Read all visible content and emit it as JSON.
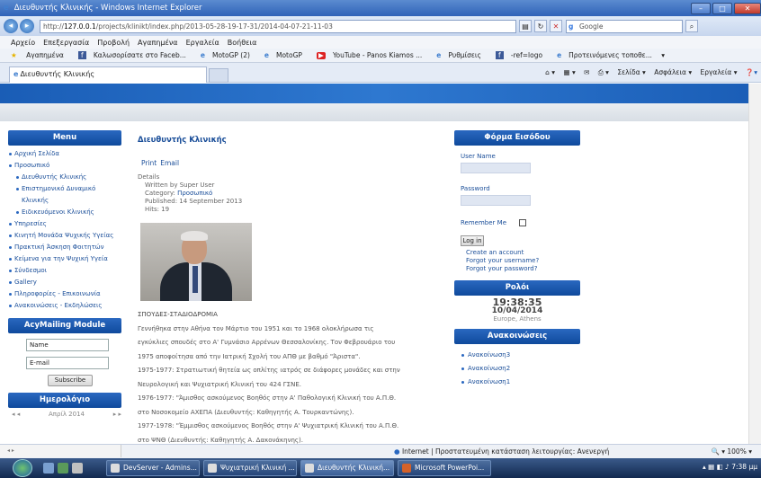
{
  "window": {
    "title": "Διευθυντής Κλινικής - Windows Internet Explorer"
  },
  "address": {
    "url_prefix": "http://",
    "url_host": "127.0.0.1",
    "url_path": "/projects/klinikt/index.php/2013-05-28-19-17-31/2014-04-07-21-11-03",
    "search_placeholder": "Google"
  },
  "menubar": [
    "Αρχείο",
    "Επεξεργασία",
    "Προβολή",
    "Αγαπημένα",
    "Εργαλεία",
    "Βοήθεια"
  ],
  "favorites": {
    "label": "Αγαπημένα",
    "items": [
      "Καλωσορίσατε στο Faceb...",
      "MotoGP (2)",
      "MotoGP",
      "YouTube - Panos Kiamos ...",
      "Ρυθμίσεις",
      "-ref=logo",
      "Προτεινόμενες τοποθε..."
    ]
  },
  "tab": {
    "label": "Διευθυντής Κλινικής"
  },
  "commandbar": [
    "Σελίδα ▾",
    "Ασφάλεια ▾",
    "Εργαλεία ▾"
  ],
  "menu": {
    "title": "Menu",
    "items": [
      {
        "label": "Αρχική Σελίδα",
        "sub": false
      },
      {
        "label": "Προσωπικό",
        "sub": false
      },
      {
        "label": "Διευθυντής Κλινικής",
        "sub": true
      },
      {
        "label": "Επιστημονικό Δυναμικό Κλινικής",
        "sub": true
      },
      {
        "label": "Ειδικευόμενοι Κλινικής",
        "sub": true
      },
      {
        "label": "Υπηρεσίες",
        "sub": false
      },
      {
        "label": "Κινητή Μονάδα Ψυχικής Υγείας",
        "sub": false
      },
      {
        "label": "Πρακτική Άσκηση Φοιτητών",
        "sub": false
      },
      {
        "label": "Κείμενα για την Ψυχική Υγεία",
        "sub": false
      },
      {
        "label": "Σύνδεσμοι",
        "sub": false
      },
      {
        "label": "Gallery",
        "sub": false
      },
      {
        "label": "Πληροφορίες - Επικοινωνία",
        "sub": false
      },
      {
        "label": "Ανακοινώσεις - Εκδηλώσεις",
        "sub": false
      }
    ]
  },
  "acymailing": {
    "title": "AcyMailing Module",
    "name_placeholder": "Name",
    "email_placeholder": "E-mail",
    "subscribe": "Subscribe"
  },
  "calendar": {
    "title": "Ημερολόγιο",
    "prev": "◂ ◂",
    "month": "Απρίλ 2014",
    "next": "▸ ▸"
  },
  "article": {
    "title": "Διευθυντής Κλινικής",
    "print": "Print",
    "email": "Email",
    "details_label": "Details",
    "written_by": "Written by Super User",
    "category_label": "Category:",
    "category": "Προσωπικό",
    "published": "Published: 14 September 2013",
    "hits": "Hits: 19",
    "bio": [
      "ΣΠΟΥΔΕΣ-ΣΤΑΔΙΟΔΡΟΜΙΑ",
      "Γεννήθηκα στην Αθήνα τον Μάρτιο του 1951 και το 1968 ολοκλήρωσα τις",
      "εγκύκλιες σπουδές στο Α' Γυμνάσιο Αρρένων Θεσσαλονίκης. Τον Φεβρουάριο του",
      "1975 αποφοίτησα από την Ιατρική Σχολή του ΑΠΘ με βαθμό \"Άριστα\".",
      "1975-1977: Στρατιωτική θητεία ως οπλίτης ιατρός σε διάφορες μονάδες και στην",
      "Νευρολογική και Ψυχιατρική Κλινική του 424 ΓΣΝΕ.",
      "1976-1977: \"Άμισθος ασκούμενος Βοηθός στην Α' Παθολογική Κλινική του Α.Π.Θ.",
      "στο Νοσοκομείο ΑΧΕΠΑ (Διευθυντής: Καθηγητής Α. Τουρκαντώνης).",
      "1977-1978: \"Έμμισθος ασκούμενος Βοηθός στην Α' Ψυχιατρική Κλινική του Α.Π.Θ.",
      "στο ΨΝΘ (Διευθυντής: Καθηγητής Α. Δακονάκηνης)."
    ]
  },
  "login": {
    "title": "Φόρμα Εισόδου",
    "username_label": "User Name",
    "password_label": "Password",
    "remember_label": "Remember Me",
    "login_button": "Log in",
    "create_account": "Create an account",
    "forgot_username": "Forgot your username?",
    "forgot_password": "Forgot your password?"
  },
  "clock": {
    "title": "Ρολόι",
    "time": "19:38:35",
    "date": "10/04/2014",
    "zone": "Europe, Athens"
  },
  "announcements": {
    "title": "Ανακοινώσεις",
    "items": [
      "Ανακοίνωση3",
      "Ανακοίνωση2",
      "Ανακοίνωση1"
    ]
  },
  "status": {
    "zone_text": "Internet | Προστατευμένη κατάσταση λειτουργίας: Ανενεργή",
    "zoom": "100%"
  },
  "taskbar": {
    "tasks": [
      {
        "label": "DevServer - Admins...",
        "active": false
      },
      {
        "label": "Ψυχιατρική Κλινική ...",
        "active": false
      },
      {
        "label": "Διευθυντής Κλινική...",
        "active": true
      },
      {
        "label": "Microsoft PowerPoi...",
        "active": false
      }
    ],
    "time": "7:38 μμ"
  }
}
